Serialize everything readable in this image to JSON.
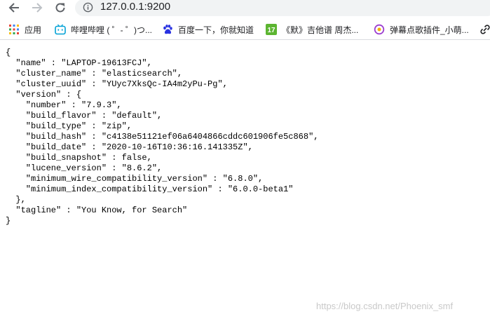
{
  "browser": {
    "url": "127.0.0.1:9200"
  },
  "bookmarks": [
    {
      "label": "应用",
      "icon": "apps-grid-icon"
    },
    {
      "label": "哔哩哔哩 ( ゜- ゜)つ...",
      "icon": "bilibili-icon"
    },
    {
      "label": "百度一下，你就知道",
      "icon": "baidu-paw-icon"
    },
    {
      "label": "《默》吉他谱 周杰...",
      "icon": "site-17-icon"
    },
    {
      "label": "弹幕点歌插件_小萌...",
      "icon": "danmu-plugin-icon"
    }
  ],
  "json_lines": [
    "{",
    "  \"name\" : \"LAPTOP-19613FCJ\",",
    "  \"cluster_name\" : \"elasticsearch\",",
    "  \"cluster_uuid\" : \"YUyc7XksQc-IA4m2yPu-Pg\",",
    "  \"version\" : {",
    "    \"number\" : \"7.9.3\",",
    "    \"build_flavor\" : \"default\",",
    "    \"build_type\" : \"zip\",",
    "    \"build_hash\" : \"c4138e51121ef06a6404866cddc601906fe5c868\",",
    "    \"build_date\" : \"2020-10-16T10:36:16.141335Z\",",
    "    \"build_snapshot\" : false,",
    "    \"lucene_version\" : \"8.6.2\",",
    "    \"minimum_wire_compatibility_version\" : \"6.8.0\",",
    "    \"minimum_index_compatibility_version\" : \"6.0.0-beta1\"",
    "  },",
    "  \"tagline\" : \"You Know, for Search\"",
    "}"
  ],
  "watermark": "https://blog.csdn.net/Phoenix_smf"
}
